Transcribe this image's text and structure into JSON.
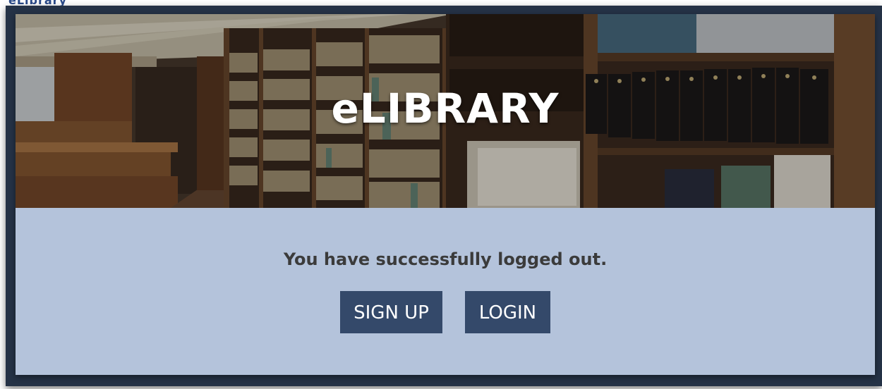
{
  "header": {
    "fragment_text": "eLibrary"
  },
  "hero": {
    "title": "eLIBRARY"
  },
  "status": {
    "message": "You have successfully logged out."
  },
  "actions": {
    "signup_label": "SIGN UP",
    "login_label": "LOGIN"
  },
  "colors": {
    "frame": "#253246",
    "panel": "#b4c3db",
    "button": "#34496a",
    "message_text": "#3b3b3b",
    "button_text": "#ffffff"
  }
}
